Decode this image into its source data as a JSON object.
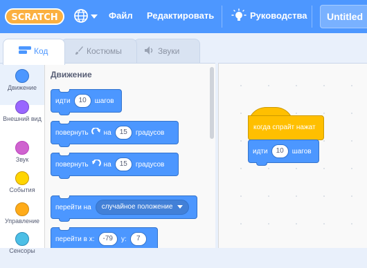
{
  "menubar": {
    "logo_text": "SCRATCH",
    "file_label": "Файл",
    "edit_label": "Редактировать",
    "tutorials_label": "Руководства",
    "project_title": "Untitled"
  },
  "tabs": [
    {
      "label": "Код"
    },
    {
      "label": "Костюмы"
    },
    {
      "label": "Звуки"
    }
  ],
  "categories": [
    {
      "label": "Движение",
      "color": "#4c97ff"
    },
    {
      "label": "Внешний вид",
      "color": "#9966ff"
    },
    {
      "label": "Звук",
      "color": "#cf63cf"
    },
    {
      "label": "События",
      "color": "#ffd500"
    },
    {
      "label": "Управление",
      "color": "#ffab19"
    },
    {
      "label": "Сенсоры",
      "color": "#4cbfe6"
    }
  ],
  "palette": {
    "title": "Движение",
    "move": {
      "prefix": "идти",
      "value": "10",
      "suffix": "шагов"
    },
    "turn_right": {
      "prefix": "повернуть",
      "middle": "на",
      "value": "15",
      "suffix": "градусов"
    },
    "turn_left": {
      "prefix": "повернуть",
      "middle": "на",
      "value": "15",
      "suffix": "градусов"
    },
    "goto": {
      "prefix": "перейти на",
      "option": "случайное положение"
    },
    "goto_xy": {
      "prefix": "перейти в x:",
      "x": "-79",
      "y_label": "y:",
      "y": "7"
    }
  },
  "script": {
    "hat_label": "когда спрайт нажат",
    "move": {
      "prefix": "идти",
      "value": "10",
      "suffix": "шагов"
    }
  }
}
